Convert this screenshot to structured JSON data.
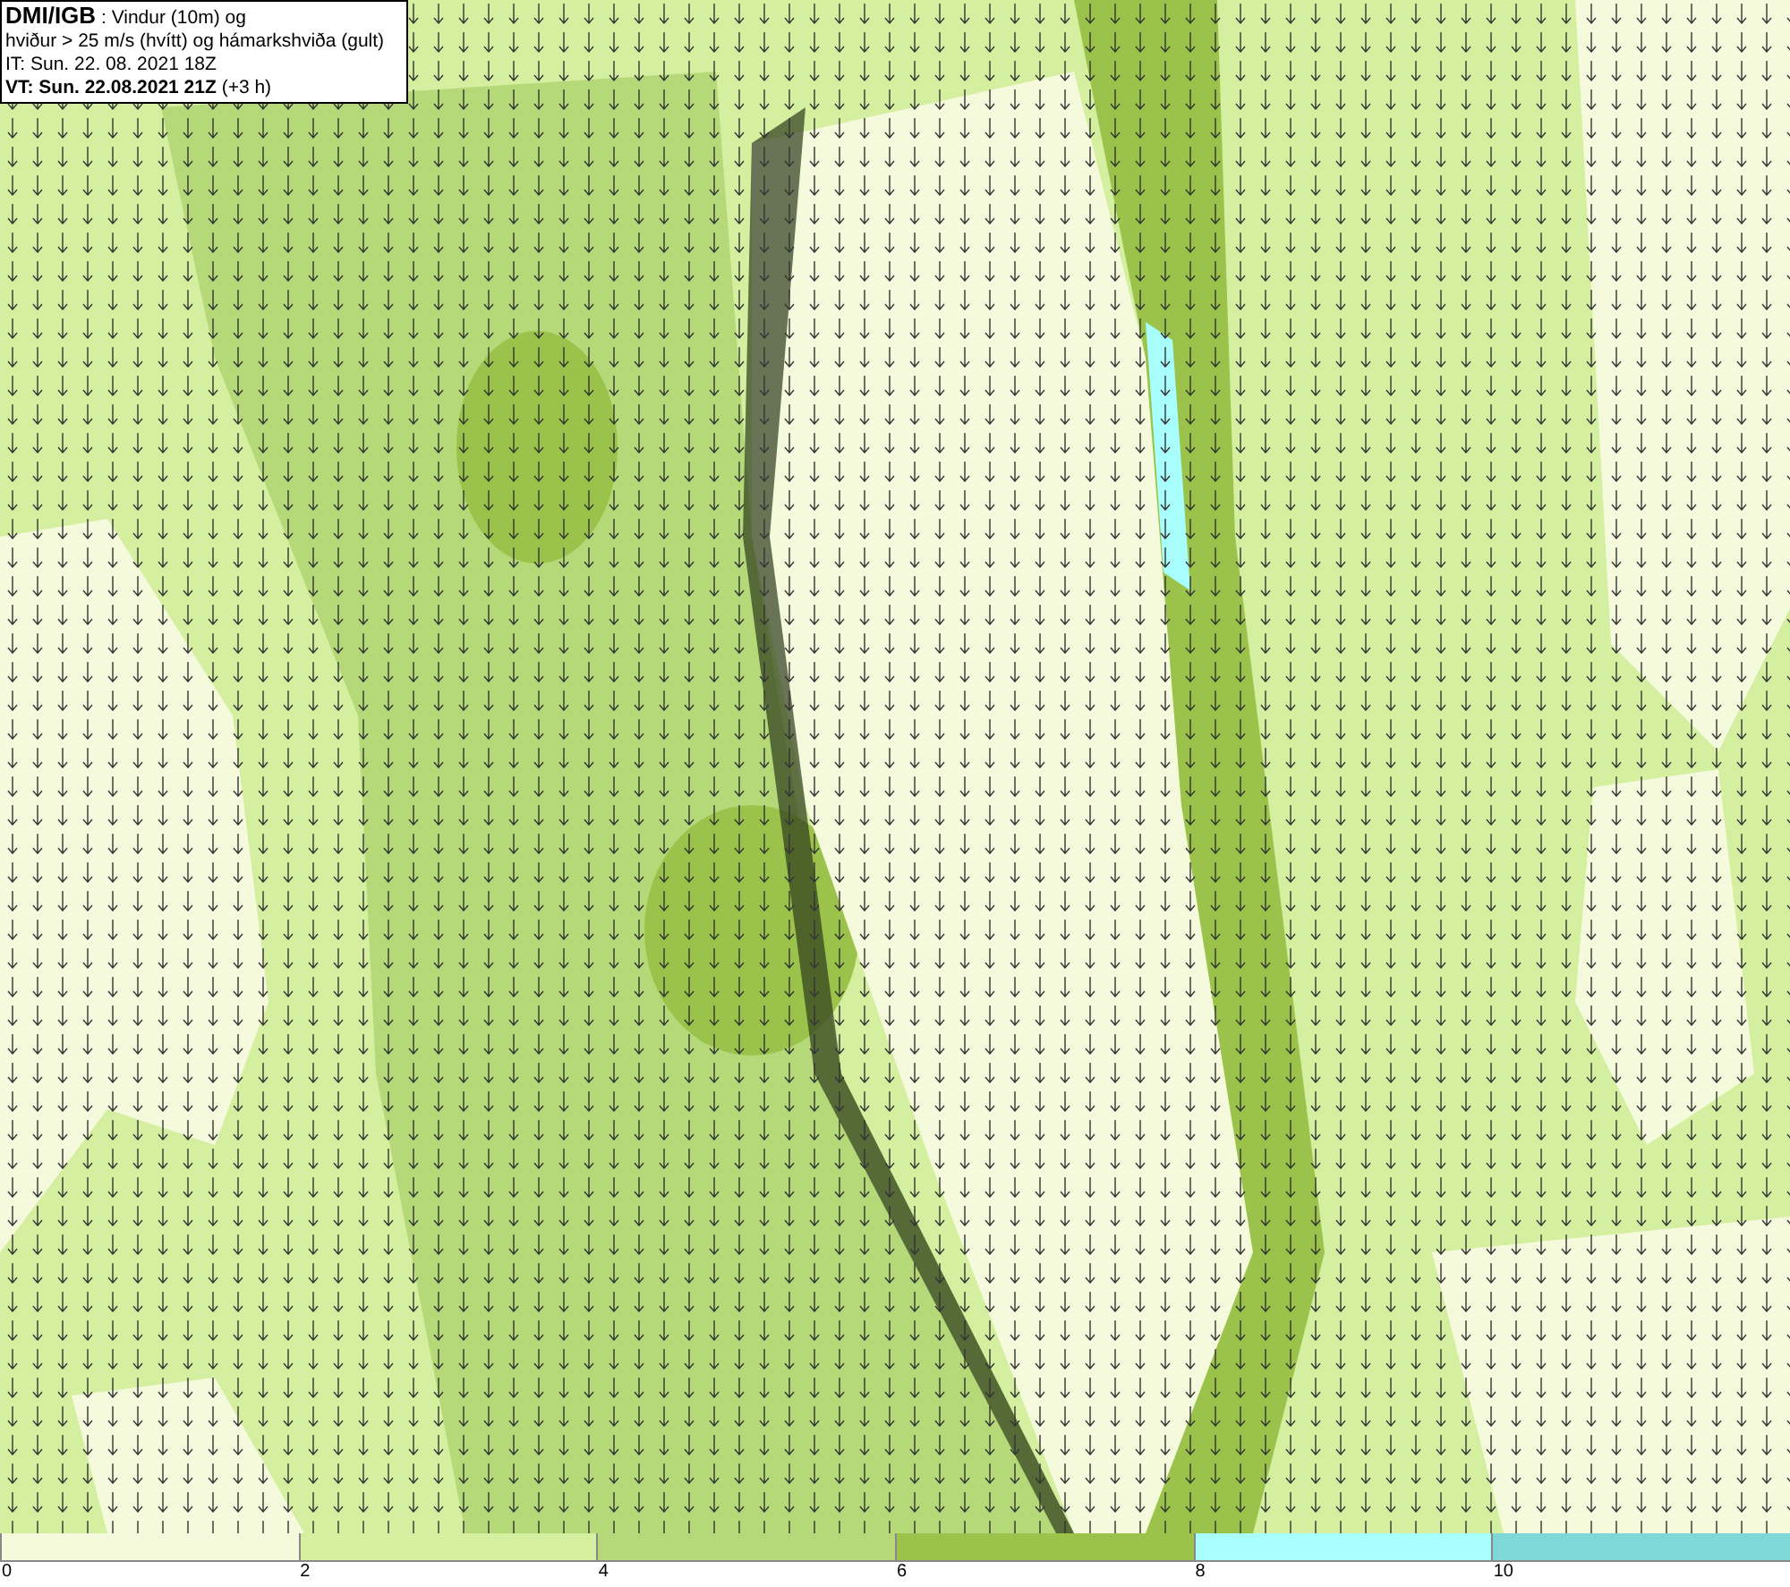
{
  "header": {
    "lines": [
      "**DMI/IGB** : Vindur (10m) og",
      "hviður > 25 m/s (hvítt) og hámarkshviða (gult)",
      "IT: Sun. 22. 08. 2021 18Z",
      "**VT: Sun. 22.08.2021 21Z** (+3 h)"
    ]
  },
  "legend": {
    "bins": [
      {
        "label": "0",
        "color": "#f5fadc"
      },
      {
        "label": "2",
        "color": "#d4ef9f"
      },
      {
        "label": "4",
        "color": "#b5d978"
      },
      {
        "label": "6",
        "color": "#9bc34b"
      },
      {
        "label": "8",
        "color": "#a8fdfd"
      },
      {
        "label": "10",
        "color": "#7fd8d8"
      }
    ]
  }
}
